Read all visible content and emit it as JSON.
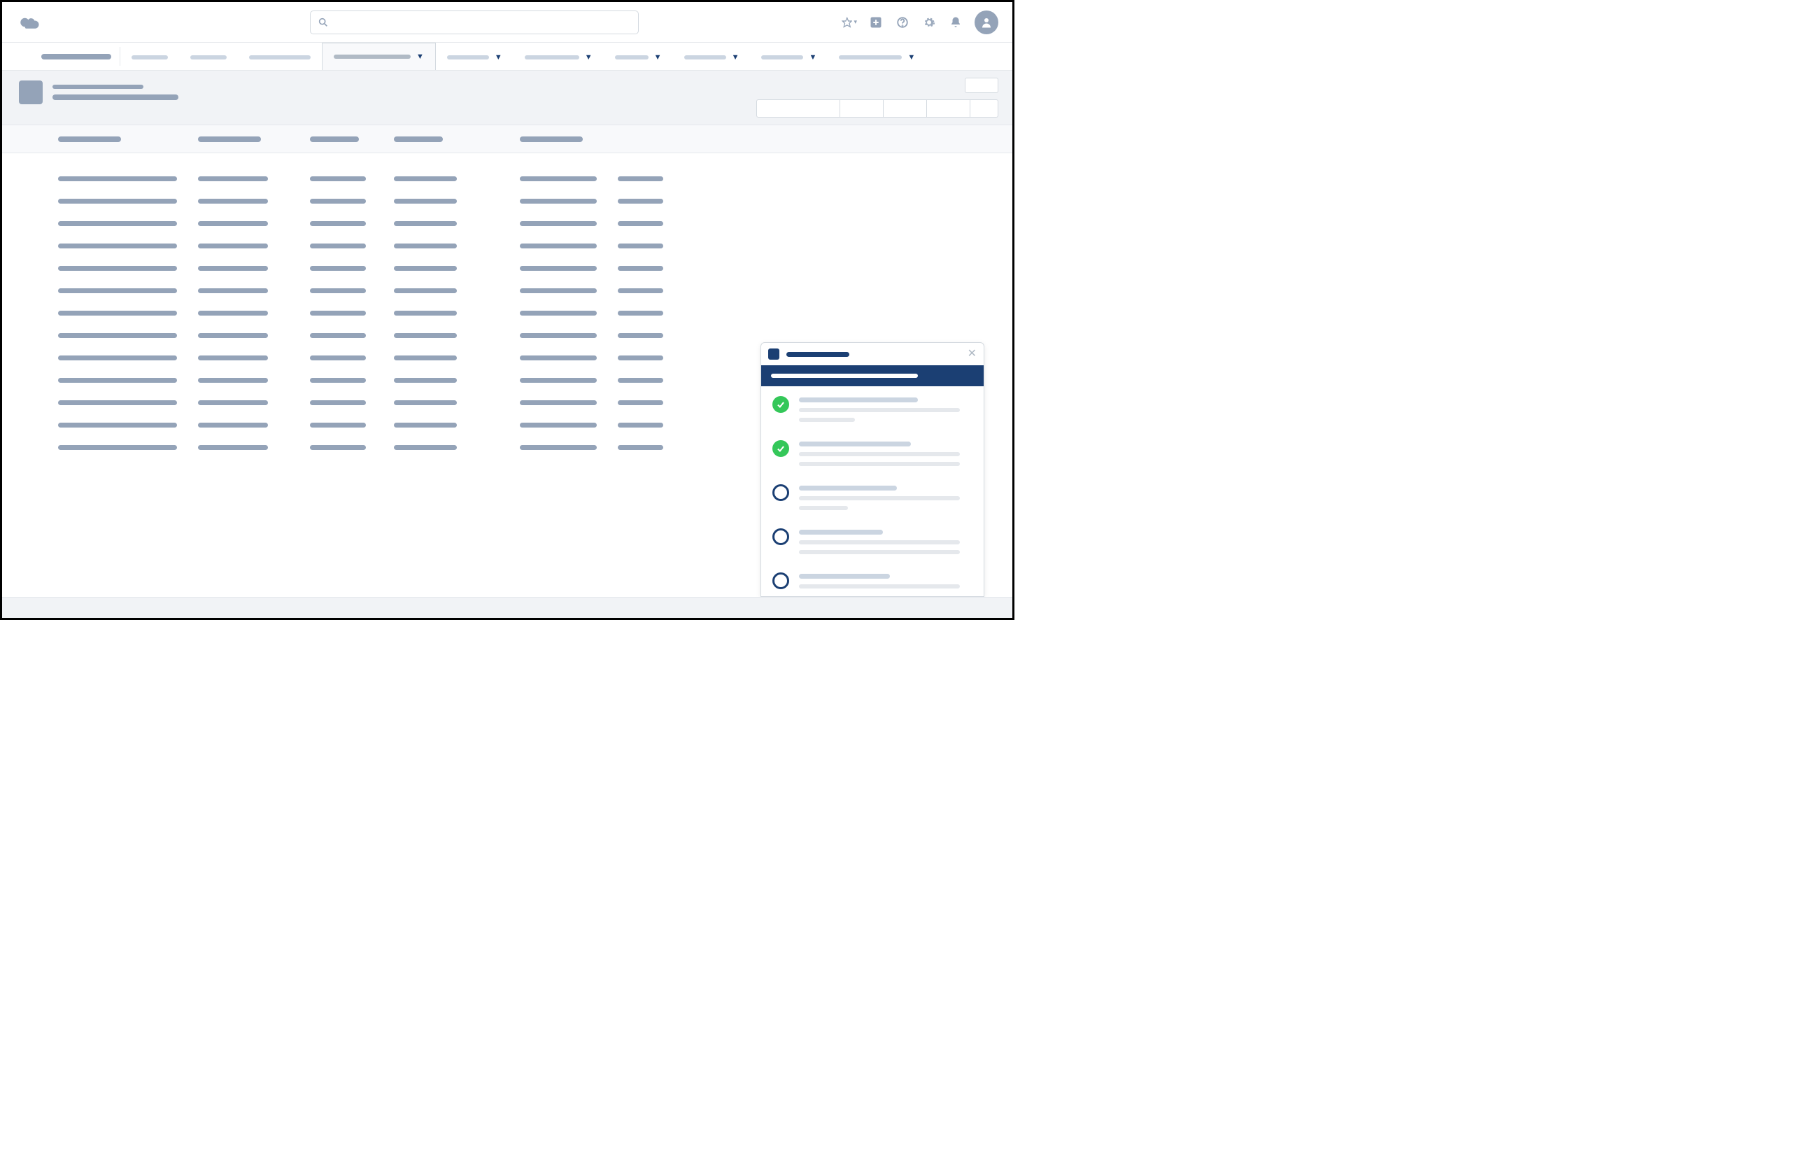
{
  "header": {
    "search_placeholder": "",
    "icons": [
      "favorites",
      "add",
      "help",
      "setup",
      "notifications",
      "user"
    ]
  },
  "nav": {
    "app_name": "",
    "tabs": [
      {
        "label": "",
        "width": 52,
        "chevron": false,
        "active": false
      },
      {
        "label": "",
        "width": 52,
        "chevron": false,
        "active": false
      },
      {
        "label": "",
        "width": 88,
        "chevron": false,
        "active": false
      },
      {
        "label": "",
        "width": 110,
        "chevron": true,
        "active": true
      },
      {
        "label": "",
        "width": 60,
        "chevron": true,
        "active": false
      },
      {
        "label": "",
        "width": 78,
        "chevron": true,
        "active": false
      },
      {
        "label": "",
        "width": 48,
        "chevron": true,
        "active": false
      },
      {
        "label": "",
        "width": 60,
        "chevron": true,
        "active": false
      },
      {
        "label": "",
        "width": 60,
        "chevron": true,
        "active": false
      },
      {
        "label": "",
        "width": 90,
        "chevron": true,
        "active": false
      }
    ]
  },
  "page_header": {
    "title": "",
    "subtitle": "",
    "top_right_action": "",
    "action_buttons_widths": [
      120,
      62,
      62,
      62,
      40
    ]
  },
  "columns": [
    "",
    "",
    "",
    "",
    ""
  ],
  "rows_count": 13,
  "panel": {
    "title": "",
    "banner": "",
    "steps": [
      {
        "status": "done",
        "title": "",
        "desc_lines": 2,
        "line1_w": 170,
        "line2a_w": 230,
        "line2b_w": 80
      },
      {
        "status": "done",
        "title": "",
        "desc_lines": 2,
        "line1_w": 160,
        "line2a_w": 230,
        "line2b_w": 230
      },
      {
        "status": "todo",
        "title": "",
        "desc_lines": 2,
        "line1_w": 140,
        "line2a_w": 230,
        "line2b_w": 70
      },
      {
        "status": "todo",
        "title": "",
        "desc_lines": 2,
        "line1_w": 120,
        "line2a_w": 230,
        "line2b_w": 230
      },
      {
        "status": "todo",
        "title": "",
        "desc_lines": 1,
        "line1_w": 130,
        "line2a_w": 230,
        "line2b_w": 0
      }
    ]
  },
  "colors": {
    "placeholder": "#94a3b8",
    "light": "#cbd5e1",
    "border": "#d4dae0",
    "navy": "#1b3f73",
    "green": "#34c759",
    "bg": "#f1f3f6"
  }
}
